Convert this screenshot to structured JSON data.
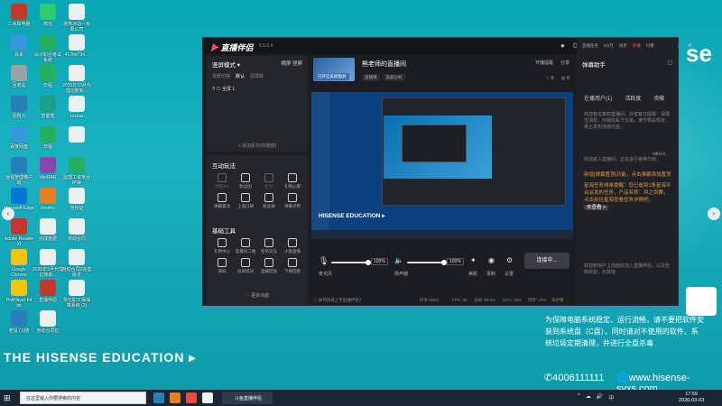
{
  "desktop": {
    "icons": [
      {
        "label": "二水和电脑",
        "color": "#c0392b"
      },
      {
        "label": "微信",
        "color": "#2ecc71"
      },
      {
        "label": "涟熊冰珀—有限公司",
        "color": "#ecf0f1"
      },
      {
        "label": "百素",
        "color": "#3498db"
      },
      {
        "label": "会计职业考试系统",
        "color": "#27ae60"
      },
      {
        "label": "417fef734...",
        "color": "#ecf0f1"
      },
      {
        "label": "回收站",
        "color": "#95a5a6"
      },
      {
        "label": "日程",
        "color": "#27ae60"
      },
      {
        "label": "2025年10月代理记账新...",
        "color": "#ecf0f1"
      },
      {
        "label": "回购元",
        "color": "#2980b9"
      },
      {
        "label": "智能笔",
        "color": "#16a085"
      },
      {
        "label": "zzzzaz",
        "color": "#ecf0f1"
      },
      {
        "label": "百度网盘",
        "color": "#3498db"
      },
      {
        "label": "日程",
        "color": "#27ae60"
      },
      {
        "label": "",
        "color": "#ecf0f1"
      },
      {
        "label": "远程管理带户端",
        "color": "#2980b9"
      },
      {
        "label": "WinRAR",
        "color": "#8e44ad"
      },
      {
        "label": "监理工资专业所得",
        "color": "#27ae60"
      },
      {
        "label": "Microsoft Edge",
        "color": "#0078d4"
      },
      {
        "label": "Firefox",
        "color": "#e67e22"
      },
      {
        "label": "身份证",
        "color": "#ecf0f1"
      },
      {
        "label": "Adobe Reader XI",
        "color": "#c0392b"
      },
      {
        "label": "完成值据",
        "color": "#ecf0f1"
      },
      {
        "label": "劳动合同",
        "color": "#ecf0f1"
      },
      {
        "label": "Google Chrome",
        "color": "#f1c40f"
      },
      {
        "label": "2025年9月代理记账新...",
        "color": "#ecf0f1"
      },
      {
        "label": "劳动合同2完善版本",
        "color": "#ecf0f1"
      },
      {
        "label": "PotPlayer 64 bit",
        "color": "#f1c40f"
      },
      {
        "label": "直播伴侣",
        "color": "#c0392b"
      },
      {
        "label": "单位职工保保障系统 (2)",
        "color": "#ecf0f1"
      },
      {
        "label": "老鼠 (1)随",
        "color": "#2980b9"
      },
      {
        "label": "劳动合同征",
        "color": "#ecf0f1"
      }
    ],
    "edu_logo": "THE HISENSE EDUCATION ▸",
    "phone": "✆4006111111",
    "website": "🌐www.hisense-syxs.com",
    "notice": "为保障电脑系统稳定、运行流畅，请不要把软件安装到系统盘（C盘），同时请对不使用的软件、系统垃圾定期清理，并进行全盘杀毒",
    "right_bleed_text": "se"
  },
  "app": {
    "logo_text": "直播伴侣",
    "version": "6.5.6.4",
    "titlebar_icons": [
      "avatar-icon",
      "lock-icon",
      "headset-icon",
      "message-icon",
      "mail-icon",
      "settings-icon",
      "menu-icon",
      "minimize-icon",
      "maximize-icon",
      "close-icon"
    ],
    "left": {
      "mode": "竖屏模式 ▾",
      "mode_right": "横屏",
      "mode_right2": "竖屏",
      "scene_tabs": [
        "场景切换",
        "默认",
        "竖屏版"
      ],
      "screen_item": "全屏 1",
      "add_source": "+ 添加素材(快捷键)",
      "interact_title": "互动玩法",
      "interact_tools": [
        {
          "label": "跨房PK",
          "dim": true
        },
        {
          "label": "粉丝团",
          "dim": false
        },
        {
          "label": "红包",
          "dim": true
        },
        {
          "label": "礼物心愿",
          "dim": false
        },
        {
          "label": "弹幕置顶",
          "dim": false
        },
        {
          "label": "上墙口碑",
          "dim": false
        },
        {
          "label": "粉丝群",
          "dim": false
        },
        {
          "label": "弹幕点赞",
          "dim": false
        }
      ],
      "basic_title": "基础工具",
      "basic_tools": [
        {
          "label": "礼物中心"
        },
        {
          "label": "直播间二维"
        },
        {
          "label": "任务玩法"
        },
        {
          "label": "小窗直播"
        },
        {
          "label": "清屏",
          "badge": ""
        },
        {
          "label": "投屏提词"
        },
        {
          "label": "直播回放"
        },
        {
          "label": "下播回看"
        }
      ],
      "more": "⋯ 更多功能"
    },
    "center": {
      "thumb_button": "已开启美颜面具",
      "room_title": "熊老师的直播间",
      "tags": [
        "直播课",
        "美颜分村"
      ],
      "top_actions": [
        "开播提醒",
        "分享"
      ],
      "likes": [
        "0",
        "0"
      ],
      "preview_edu": "HISENSE EDUCATION ▸",
      "mic_label": "麦克风",
      "mic_pct": "100%",
      "speaker_label": "扬声器",
      "speaker_pct": "100%",
      "ctl_labels": [
        "美颜",
        "录制",
        "设置"
      ],
      "start_button": "连接中...",
      "status": {
        "hint": "ⓘ 如何快速上手直播伴侣?",
        "bitrate": "码率 0kb/s",
        "fps": "FPS: 30",
        "drop": "丢帧: 00.0%",
        "cpu": "CPU: 16%",
        "mem": "内存: 47%",
        "state": "未开播"
      }
    },
    "right": {
      "head": "弹幕助手",
      "close": "▢",
      "top_counts": [
        "直播任务",
        "0/2万",
        "同步",
        "开播",
        "付费"
      ],
      "tabs": [
        "在播用户(1)",
        "活跃度",
        "贡献"
      ],
      "msg1": "欢迎各位来到直播间，抖音官方提醒：请理性消费，勿相信私下交易，遵守相关规定，禁止发布违规内容。",
      "badge": "0条/0人",
      "msg2": "欢迎进入直播间，正在进行各种节目。",
      "task_line1": "新增[弹幕置顶]功能，点击弹幕添加置顶",
      "task_line2": "星海任务排单提醒：您已收到1条星海平台派发的任务，产品名称：风之剑舞，点击前往星海查看任务详情吧。",
      "task_link": "去查看 >",
      "msg3": "欢迎新用户上前面欢迎入直播伴侣，以及告知欢迎，对其他"
    }
  },
  "taskbar": {
    "search_placeholder": "在这里输入你要搜索的内容",
    "active_app": "斗鱼直播伴侣",
    "time": "17:59",
    "date": "2026-03-03",
    "tray": [
      "^",
      "☁",
      "🔊",
      "中"
    ]
  }
}
